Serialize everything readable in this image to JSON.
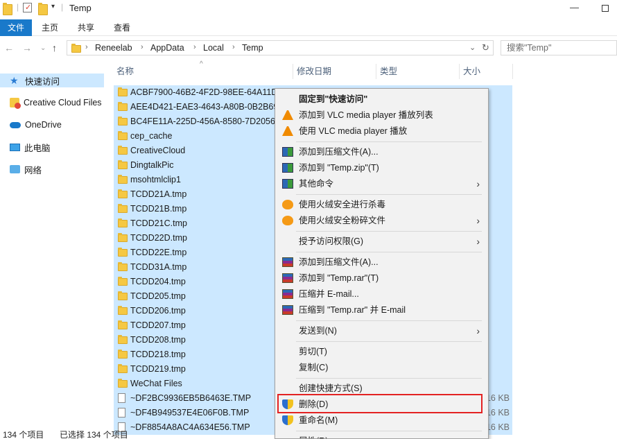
{
  "window": {
    "title": "Temp"
  },
  "ribbon": {
    "tabs": [
      "文件",
      "主页",
      "共享",
      "查看"
    ]
  },
  "address": {
    "segments": [
      "Reneelab",
      "AppData",
      "Local",
      "Temp"
    ],
    "search_placeholder": "搜索\"Temp\""
  },
  "sidebar": {
    "items": [
      {
        "label": "快速访问",
        "icon": "star-icon"
      },
      {
        "label": "Creative Cloud Files",
        "icon": "creative-cloud-icon"
      },
      {
        "label": "OneDrive",
        "icon": "cloud-icon"
      },
      {
        "label": "此电脑",
        "icon": "computer-icon"
      },
      {
        "label": "网络",
        "icon": "network-icon"
      }
    ]
  },
  "columns": {
    "name": "名称",
    "date": "修改日期",
    "type": "类型",
    "size": "大小"
  },
  "files": [
    {
      "name": "ACBF7900-46B2-4F2D-98EE-64A11D",
      "kind": "folder",
      "size": ""
    },
    {
      "name": "AEE4D421-EAE3-4643-A80B-0B2B69",
      "kind": "folder",
      "size": ""
    },
    {
      "name": "BC4FE11A-225D-456A-8580-7D2056",
      "kind": "folder",
      "size": ""
    },
    {
      "name": "cep_cache",
      "kind": "folder",
      "size": ""
    },
    {
      "name": "CreativeCloud",
      "kind": "folder",
      "size": ""
    },
    {
      "name": "DingtalkPic",
      "kind": "folder",
      "size": ""
    },
    {
      "name": "msohtmlclip1",
      "kind": "folder",
      "size": ""
    },
    {
      "name": "TCDD21A.tmp",
      "kind": "folder",
      "size": ""
    },
    {
      "name": "TCDD21B.tmp",
      "kind": "folder",
      "size": ""
    },
    {
      "name": "TCDD21C.tmp",
      "kind": "folder",
      "size": ""
    },
    {
      "name": "TCDD22D.tmp",
      "kind": "folder",
      "size": ""
    },
    {
      "name": "TCDD22E.tmp",
      "kind": "folder",
      "size": ""
    },
    {
      "name": "TCDD31A.tmp",
      "kind": "folder",
      "size": ""
    },
    {
      "name": "TCDD204.tmp",
      "kind": "folder",
      "size": ""
    },
    {
      "name": "TCDD205.tmp",
      "kind": "folder",
      "size": ""
    },
    {
      "name": "TCDD206.tmp",
      "kind": "folder",
      "size": ""
    },
    {
      "name": "TCDD207.tmp",
      "kind": "folder",
      "size": ""
    },
    {
      "name": "TCDD208.tmp",
      "kind": "folder",
      "size": ""
    },
    {
      "name": "TCDD218.tmp",
      "kind": "folder",
      "size": ""
    },
    {
      "name": "TCDD219.tmp",
      "kind": "folder",
      "size": ""
    },
    {
      "name": "WeChat Files",
      "kind": "folder",
      "size": ""
    },
    {
      "name": "~DF2BC9936EB5B6463E.TMP",
      "kind": "file",
      "size": "16 KB"
    },
    {
      "name": "~DF4B949537E4E06F0B.TMP",
      "kind": "file",
      "size": "16 KB"
    },
    {
      "name": "~DF8854A8AC4A634E56.TMP",
      "kind": "file",
      "size": "16 KB"
    }
  ],
  "context_menu": {
    "items": [
      {
        "label": "固定到\"快速访问\"",
        "icon": "",
        "bold": true,
        "submenu": false
      },
      {
        "label": "添加到 VLC media player 播放列表",
        "icon": "vlc-icon",
        "submenu": false
      },
      {
        "label": "使用 VLC media player 播放",
        "icon": "vlc-icon",
        "submenu": false
      },
      {
        "sep": true
      },
      {
        "label": "添加到压缩文件(A)...",
        "icon": "winzip-icon",
        "submenu": false
      },
      {
        "label": "添加到 \"Temp.zip\"(T)",
        "icon": "winzip-icon",
        "submenu": false
      },
      {
        "label": "其他命令",
        "icon": "winzip-icon",
        "submenu": true
      },
      {
        "sep": true
      },
      {
        "label": "使用火绒安全进行杀毒",
        "icon": "huorong-icon",
        "submenu": false
      },
      {
        "label": "使用火绒安全粉碎文件",
        "icon": "huorong-icon",
        "submenu": true
      },
      {
        "sep": true
      },
      {
        "label": "授予访问权限(G)",
        "icon": "",
        "submenu": true
      },
      {
        "sep": true
      },
      {
        "label": "添加到压缩文件(A)...",
        "icon": "winrar-icon",
        "submenu": false
      },
      {
        "label": "添加到 \"Temp.rar\"(T)",
        "icon": "winrar-icon",
        "submenu": false
      },
      {
        "label": "压缩并 E-mail...",
        "icon": "winrar-icon",
        "submenu": false
      },
      {
        "label": "压缩到 \"Temp.rar\" 并 E-mail",
        "icon": "winrar-icon",
        "submenu": false
      },
      {
        "sep": true
      },
      {
        "label": "发送到(N)",
        "icon": "",
        "submenu": true
      },
      {
        "sep": true
      },
      {
        "label": "剪切(T)",
        "icon": "",
        "submenu": false
      },
      {
        "label": "复制(C)",
        "icon": "",
        "submenu": false
      },
      {
        "sep": true
      },
      {
        "label": "创建快捷方式(S)",
        "icon": "",
        "submenu": false
      },
      {
        "label": "删除(D)",
        "icon": "shield-icon",
        "submenu": false,
        "highlighted": true
      },
      {
        "label": "重命名(M)",
        "icon": "shield-icon",
        "submenu": false
      },
      {
        "sep": true
      },
      {
        "label": "属性(R)",
        "icon": "",
        "submenu": false
      }
    ]
  },
  "status": {
    "count": "134 个项目",
    "selected": "已选择 134 个项目"
  }
}
